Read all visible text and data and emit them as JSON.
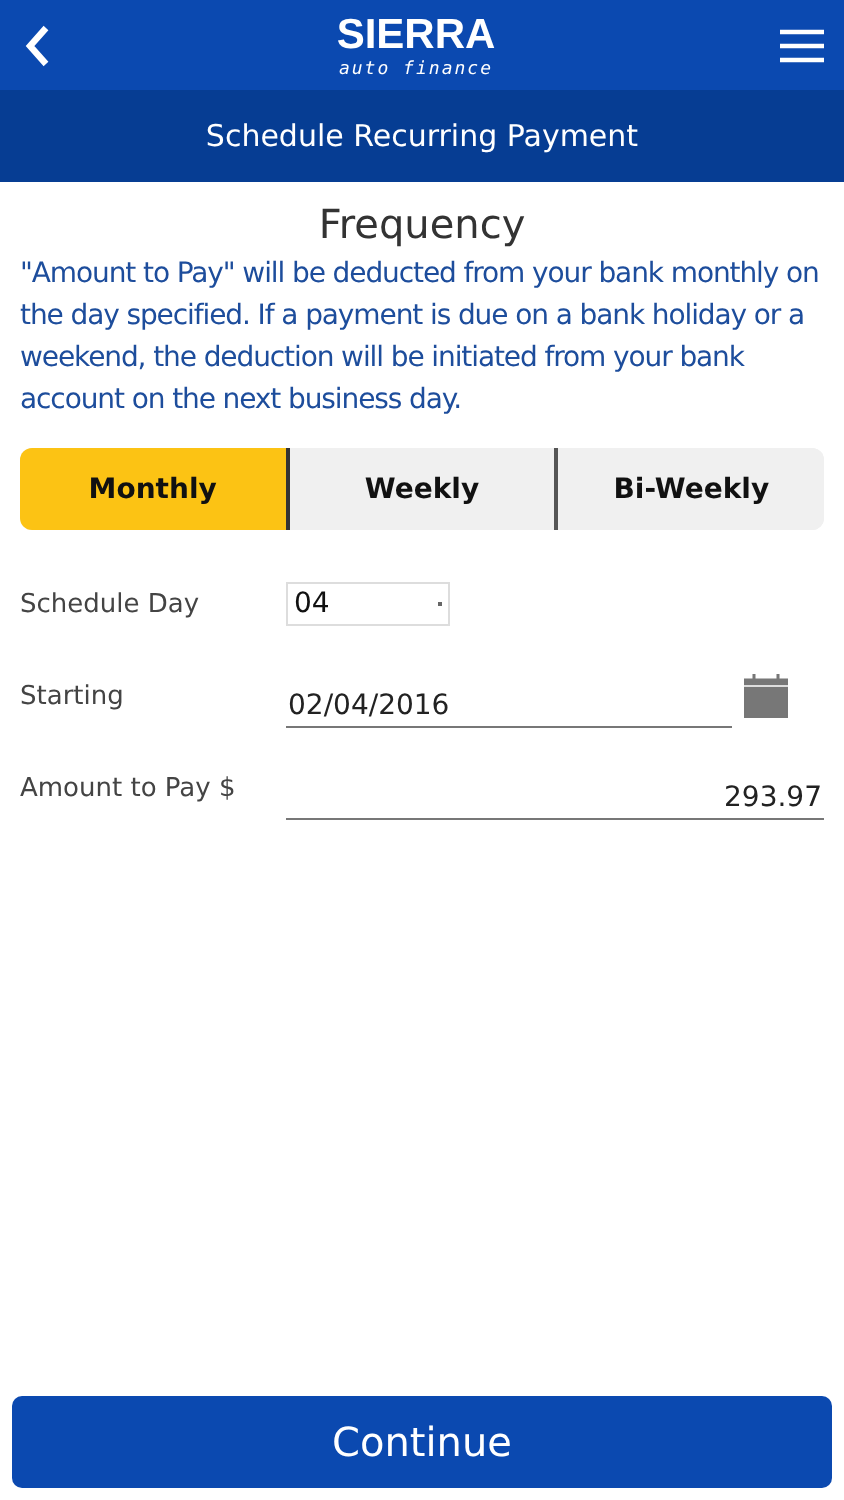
{
  "header": {
    "logo_title": "SIERRA",
    "logo_subtitle": "auto finance"
  },
  "page_title": "Schedule Recurring Payment",
  "section_title": "Frequency",
  "description": "\"Amount to Pay\" will be deducted from your bank monthly on the day specified. If a payment is due on a bank holiday or a weekend, the deduction will be initiated from your bank account on the next business day.",
  "tabs": [
    {
      "label": "Monthly",
      "selected": true
    },
    {
      "label": "Weekly",
      "selected": false
    },
    {
      "label": "Bi-Weekly",
      "selected": false
    }
  ],
  "fields": [
    {
      "kind": "select",
      "label": "Schedule Day",
      "value": "04"
    },
    {
      "kind": "date",
      "label": "Starting",
      "value": "02/04/2016"
    },
    {
      "kind": "amount",
      "label": "Amount to Pay $",
      "value": "293.97"
    }
  ],
  "continue_button": "Continue"
}
